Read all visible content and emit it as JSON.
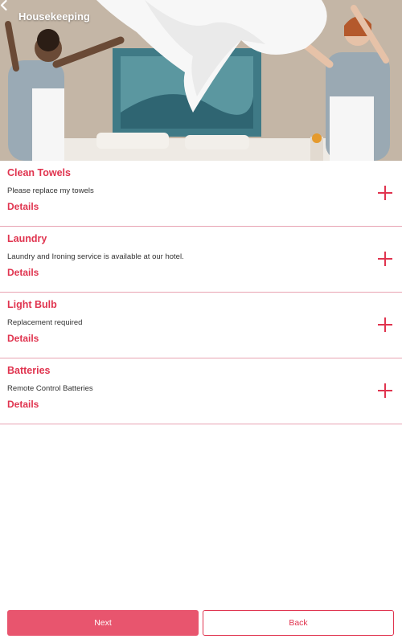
{
  "header": {
    "title": "Housekeeping",
    "back_icon": "chevron-left-icon"
  },
  "colors": {
    "accent": "#e0344f",
    "next_button": "#e8556e",
    "divider": "#e8a3b2"
  },
  "items": [
    {
      "title": "Clean Towels",
      "description": "Please replace my towels",
      "details": "Details",
      "action_icon": "plus-icon"
    },
    {
      "title": "Laundry",
      "description": "Laundry and Ironing service is available at our hotel.",
      "details": "Details",
      "action_icon": "plus-icon"
    },
    {
      "title": "Light Bulb",
      "description": "Replacement required",
      "details": "Details",
      "action_icon": "plus-icon"
    },
    {
      "title": "Batteries",
      "description": "Remote Control Batteries",
      "details": "Details",
      "action_icon": "plus-icon"
    }
  ],
  "footer": {
    "next_label": "Next",
    "back_label": "Back"
  }
}
